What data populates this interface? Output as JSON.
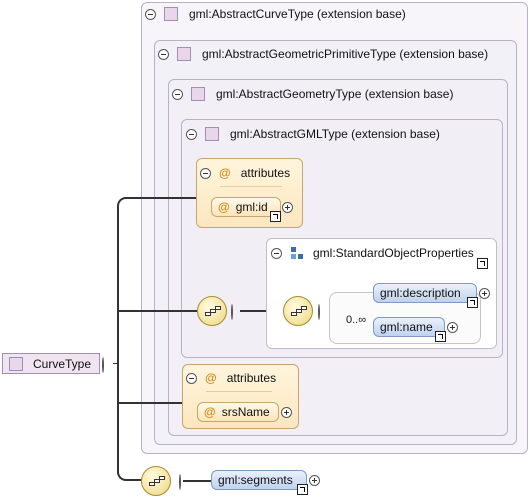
{
  "root": {
    "label": "CurveType"
  },
  "extensions": [
    {
      "label": "gml:AbstractCurveType (extension base)"
    },
    {
      "label": "gml:AbstractGeometricPrimitiveType (extension base)"
    },
    {
      "label": "gml:AbstractGeometryType (extension base)"
    },
    {
      "label": "gml:AbstractGMLType (extension base)"
    }
  ],
  "attributes_top": {
    "label": "attributes",
    "items": [
      "gml:id"
    ]
  },
  "standard_group": {
    "label": "gml:StandardObjectProperties",
    "elements": [
      "gml:description",
      "gml:name"
    ],
    "occurrence": "0..∞"
  },
  "attributes_bottom": {
    "label": "attributes",
    "items": [
      "srsName"
    ]
  },
  "segments": {
    "label": "gml:segments"
  },
  "colors": {
    "extension_border": "#b9b2c6",
    "attribute_fill": "#fbe7bf",
    "element_fill": "#bfd2ef",
    "sequence_fill": "#ecd77c"
  },
  "icons": [
    "minus-circle-icon",
    "plus-circle-icon",
    "link-arrow-icon",
    "sequence-icon",
    "group-icon",
    "attribute-at-icon",
    "type-box-icon"
  ]
}
